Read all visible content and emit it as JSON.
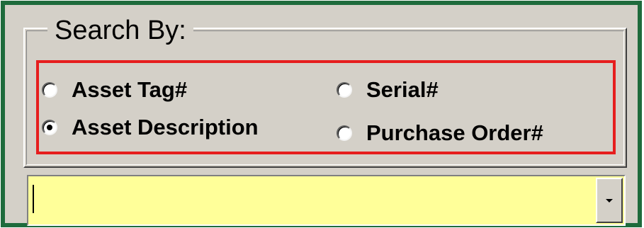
{
  "search_group": {
    "legend": "Search By:",
    "options": [
      {
        "label": "Asset Tag#",
        "checked": false
      },
      {
        "label": "Asset Description",
        "checked": true
      },
      {
        "label": "Serial#",
        "checked": false
      },
      {
        "label": "Purchase Order#",
        "checked": false
      }
    ],
    "highlight_color": "#e61e1e"
  },
  "search_combo": {
    "value": "",
    "background_color": "#ffff99",
    "dropdown_icon": "chevron-down-icon"
  },
  "frame": {
    "border_color": "#1e6b3c",
    "background_color": "#d4d0c8"
  }
}
